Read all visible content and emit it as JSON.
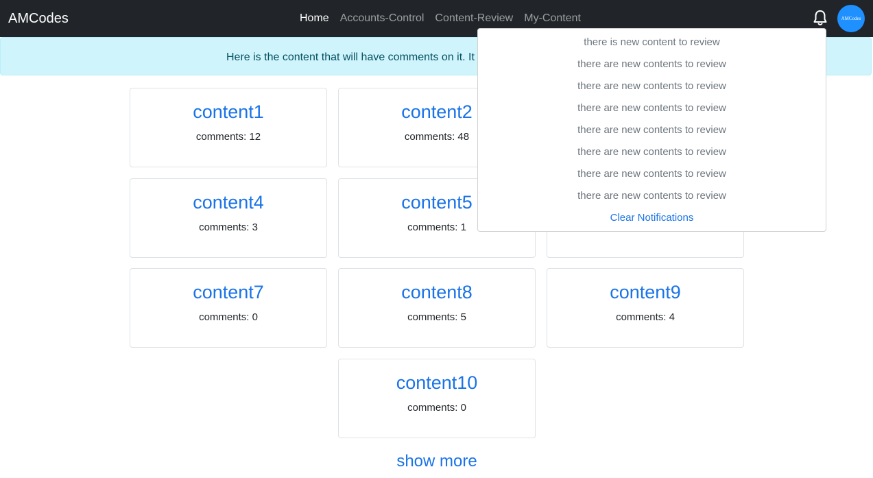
{
  "navbar": {
    "brand": "AMCodes",
    "links": [
      "Home",
      "Accounts-Control",
      "Content-Review",
      "My-Content"
    ],
    "avatar_text": "AMCodes"
  },
  "alert": {
    "text": "Here is the content that will have comments on it. It"
  },
  "cards": [
    {
      "title": "content1",
      "comments": "comments: 12"
    },
    {
      "title": "content2",
      "comments": "comments: 48"
    },
    {
      "title": "content4",
      "comments": "comments: 3"
    },
    {
      "title": "content5",
      "comments": "comments: 1"
    },
    {
      "title": "content7",
      "comments": "comments: 0"
    },
    {
      "title": "content8",
      "comments": "comments: 5"
    },
    {
      "title": "content9",
      "comments": "comments: 4"
    },
    {
      "title": "content10",
      "comments": "comments: 0"
    }
  ],
  "show_more": "show more",
  "notifications": {
    "items": [
      "there is new content to review",
      "there are new contents to review",
      "there are new contents to review",
      "there are new contents to review",
      "there are new contents to review",
      "there are new contents to review",
      "there are new contents to review",
      "there are new contents to review"
    ],
    "clear_label": "Clear Notifications"
  },
  "colors": {
    "navbar": "#212529",
    "link": "#1a73e8",
    "alert_bg": "#cff4fc",
    "avatar": "#1e90ff"
  }
}
